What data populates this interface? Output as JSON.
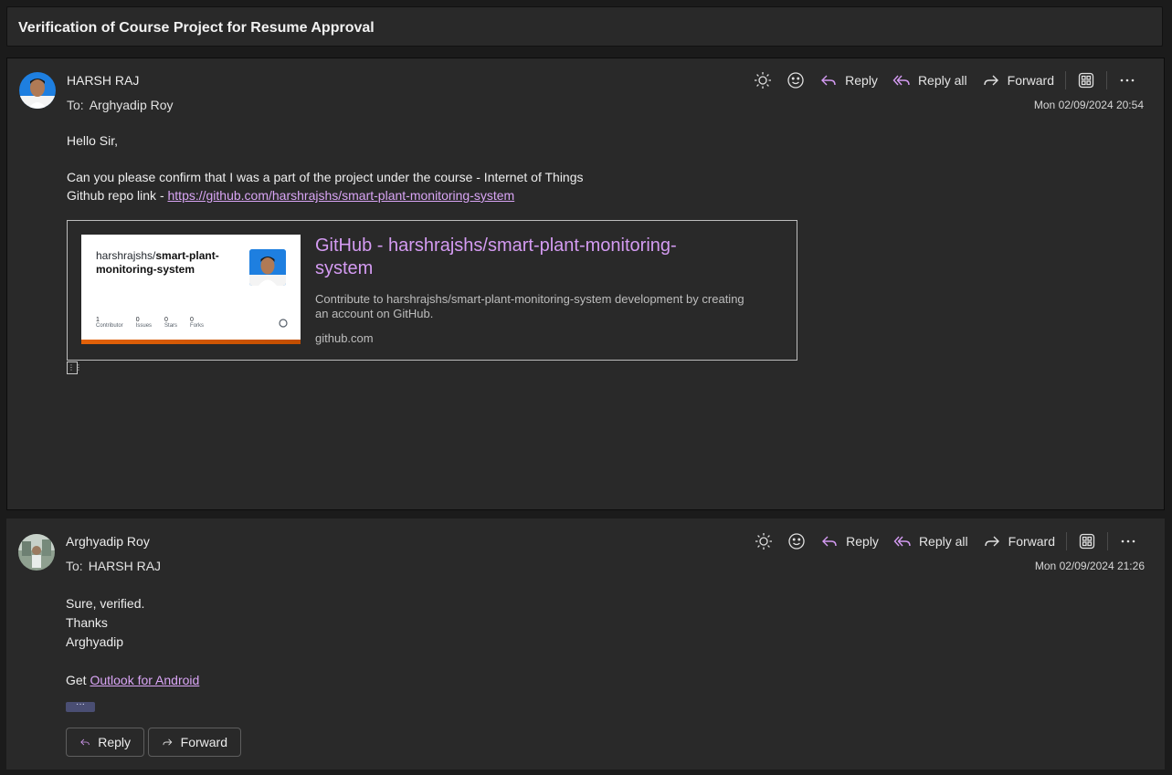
{
  "subject": "Verification of Course Project for Resume Approval",
  "colors": {
    "accent": "#d49bf2",
    "link": "#d9a5f5",
    "background": "#292929"
  },
  "toolbar": {
    "reply_label": "Reply",
    "reply_all_label": "Reply all",
    "forward_label": "Forward",
    "icons": [
      "sun-icon",
      "emoji-icon",
      "reply-icon",
      "reply-all-icon",
      "forward-icon",
      "apps-icon",
      "more-icon"
    ]
  },
  "messages": [
    {
      "sender": "HARSH RAJ",
      "to_label": "To:",
      "to": "Arghyadip Roy",
      "timestamp": "Mon 02/09/2024 20:54",
      "greeting": "Hello Sir,",
      "line1": "Can you please confirm that I was a part of the project under the course - Internet of Things",
      "line2_prefix": "Github repo link  - ",
      "link": "https://github.com/harshrajshs/smart-plant-monitoring-system",
      "card": {
        "thumb_owner": "harshrajshs/",
        "thumb_repo": "smart-plant-monitoring-system",
        "stats": [
          {
            "value": "1",
            "label": "Contributor"
          },
          {
            "value": "0",
            "label": "Issues"
          },
          {
            "value": "0",
            "label": "Stars"
          },
          {
            "value": "0",
            "label": "Forks"
          }
        ],
        "title": "GitHub - harshrajshs/smart-plant-monitoring-system",
        "description": "Contribute to harshrajshs/smart-plant-monitoring-system development by creating an account on GitHub.",
        "domain": "github.com"
      }
    },
    {
      "sender": "Arghyadip Roy",
      "to_label": "To:",
      "to": "HARSH RAJ",
      "timestamp": "Mon 02/09/2024 21:26",
      "lines": [
        "Sure, verified.",
        "Thanks",
        "Arghyadip"
      ],
      "get_prefix": "Get ",
      "get_link": "Outlook for Android",
      "more_label": "···",
      "reply_button": "Reply",
      "forward_button": "Forward"
    }
  ]
}
